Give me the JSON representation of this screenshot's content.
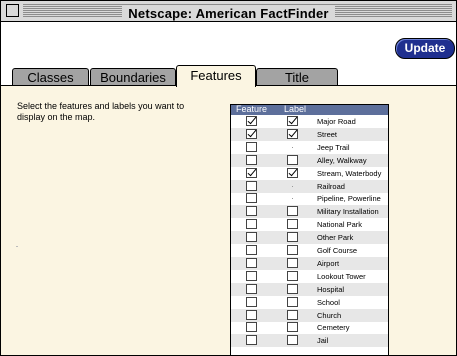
{
  "window": {
    "title": "Netscape: American FactFinder"
  },
  "toolbar": {
    "update_label": "Update"
  },
  "tabs": [
    {
      "label": "Classes",
      "active": false
    },
    {
      "label": "Boundaries",
      "active": false
    },
    {
      "label": "Features",
      "active": true
    },
    {
      "label": "Title",
      "active": false
    }
  ],
  "panel": {
    "instructions": "Select the features and labels you want to display on the map."
  },
  "table": {
    "header_feature": "Feature",
    "header_label": "Label",
    "rows": [
      {
        "name": "Major Road",
        "feature": true,
        "label": true,
        "label_box": true
      },
      {
        "name": "Street",
        "feature": true,
        "label": true,
        "label_box": true
      },
      {
        "name": "Jeep Trail",
        "feature": false,
        "label": false,
        "label_box": false
      },
      {
        "name": "Alley, Walkway",
        "feature": false,
        "label": false,
        "label_box": true
      },
      {
        "name": "Stream, Waterbody",
        "feature": true,
        "label": true,
        "label_box": true
      },
      {
        "name": "Railroad",
        "feature": false,
        "label": false,
        "label_box": false
      },
      {
        "name": "Pipeline, Powerline",
        "feature": false,
        "label": false,
        "label_box": false
      },
      {
        "name": "Military Installation",
        "feature": false,
        "label": false,
        "label_box": true
      },
      {
        "name": "National Park",
        "feature": false,
        "label": false,
        "label_box": true
      },
      {
        "name": "Other Park",
        "feature": false,
        "label": false,
        "label_box": true
      },
      {
        "name": "Golf Course",
        "feature": false,
        "label": false,
        "label_box": true
      },
      {
        "name": "Airport",
        "feature": false,
        "label": false,
        "label_box": true
      },
      {
        "name": "Lookout Tower",
        "feature": false,
        "label": false,
        "label_box": true
      },
      {
        "name": "Hospital",
        "feature": false,
        "label": false,
        "label_box": true
      },
      {
        "name": "School",
        "feature": false,
        "label": false,
        "label_box": true
      },
      {
        "name": "Church",
        "feature": false,
        "label": false,
        "label_box": true
      },
      {
        "name": "Cemetery",
        "feature": false,
        "label": false,
        "label_box": true
      },
      {
        "name": "Jail",
        "feature": false,
        "label": false,
        "label_box": true
      }
    ]
  },
  "colors": {
    "panel_bg": "#fbf5e2",
    "inactive_tab": "#a3a3a3",
    "update_button": "#1f2f8f",
    "table_header": "#5d6f9b"
  }
}
